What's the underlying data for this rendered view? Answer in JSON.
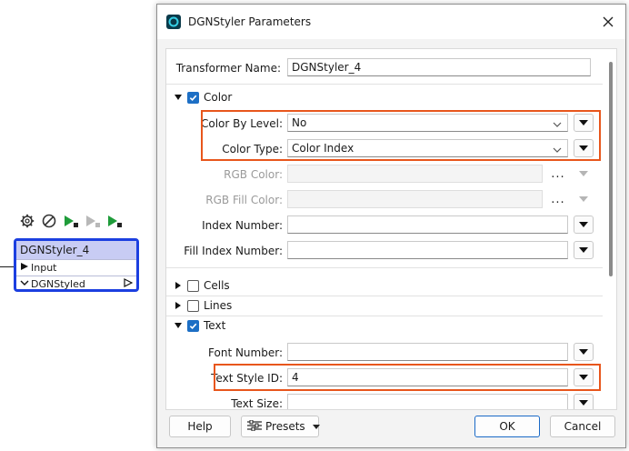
{
  "canvas": {
    "node_title": "DGNStyler_4",
    "input_port": "Input",
    "output_port": "DGNStyled"
  },
  "toolbar_icons": [
    "gear-icon",
    "disable-icon",
    "run-to-icon",
    "run-from-icon",
    "run-icon"
  ],
  "dialog": {
    "title": "DGNStyler Parameters",
    "transformer_name_label": "Transformer Name:",
    "transformer_name_value": "DGNStyler_4",
    "sections": {
      "color": {
        "label": "Color",
        "checked": true,
        "expanded": true,
        "color_by_level_label": "Color By Level:",
        "color_by_level_value": "No",
        "color_type_label": "Color Type:",
        "color_type_value": "Color Index",
        "rgb_color_label": "RGB Color:",
        "rgb_fill_color_label": "RGB Fill Color:",
        "index_number_label": "Index Number:",
        "fill_index_number_label": "Fill Index Number:"
      },
      "cells": {
        "label": "Cells",
        "checked": false,
        "expanded": false
      },
      "lines": {
        "label": "Lines",
        "checked": false,
        "expanded": false
      },
      "text": {
        "label": "Text",
        "checked": true,
        "expanded": true,
        "font_number_label": "Font Number:",
        "text_style_id_label": "Text Style ID:",
        "text_style_id_value": "4",
        "text_size_label": "Text Size:"
      }
    },
    "ellipsis": "...",
    "buttons": {
      "help": "Help",
      "presets": "Presets",
      "ok": "OK",
      "cancel": "Cancel"
    }
  },
  "colors": {
    "highlight": "#e8561c",
    "node_border": "#1c3fe0",
    "checkbox": "#1d6fc5"
  }
}
